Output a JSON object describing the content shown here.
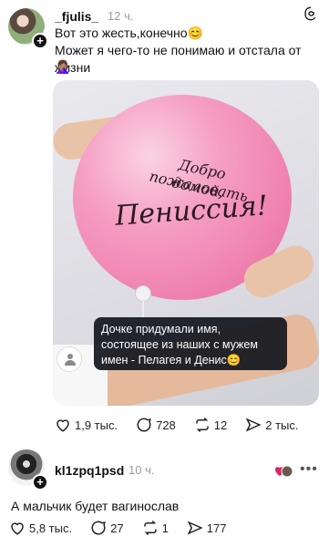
{
  "post1": {
    "username": "_fjulis_",
    "time": "12 ч.",
    "line1": "Вот это жесть,конечно😊",
    "line2": "Может я чего-то не понимаю и отстала от жизни",
    "line3": "🤦🏽‍♀️",
    "media": {
      "balloon_line1": "Добро пожаловать",
      "balloon_line2": "домой,",
      "balloon_line3": "Пениссия!",
      "caption": "Дочке придумали имя, состоящее из наших с мужем имен - Пелагея и Денис😊"
    },
    "stats": {
      "likes": "1,9 тыс.",
      "replies": "728",
      "reposts": "12",
      "shares": "2 тыс."
    }
  },
  "post2": {
    "username": "kl1zpq1psd",
    "time": "10 ч.",
    "text": "А мальчик будет вагинослав",
    "stats": {
      "likes": "5,8 тыс.",
      "replies": "27",
      "reposts": "1",
      "shares": "177"
    }
  },
  "icons": {
    "threads": "threads-logo-icon",
    "like": "heart-icon",
    "reply": "comment-icon",
    "repost": "repost-icon",
    "share": "send-icon",
    "more": "more-icon"
  }
}
